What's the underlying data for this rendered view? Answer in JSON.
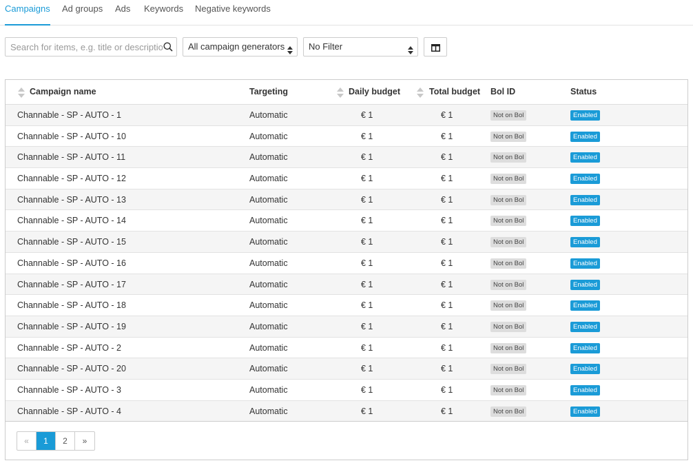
{
  "tabs": [
    {
      "label": "Campaigns",
      "active": true
    },
    {
      "label": "Ad groups",
      "active": false
    },
    {
      "label": "Ads",
      "active": false
    },
    {
      "label": "Keywords",
      "active": false
    },
    {
      "label": "Negative keywords",
      "active": false
    }
  ],
  "toolbar": {
    "search_placeholder": "Search for items, e.g. title or description",
    "search_value": "",
    "generator_select": "All campaign generators",
    "filter_select": "No Filter",
    "icons": {
      "search": "search-icon",
      "columns": "columns-icon",
      "caret": "sort-caret-icon"
    }
  },
  "table": {
    "headers": {
      "campaign_name": "Campaign name",
      "targeting": "Targeting",
      "daily_budget": "Daily budget",
      "total_budget": "Total budget",
      "bol_id": "Bol ID",
      "status": "Status"
    },
    "rows": [
      {
        "name": "Channable - SP - AUTO - 1",
        "targeting": "Automatic",
        "daily": "€ 1",
        "total": "€ 1",
        "bol": "Not on Bol",
        "status": "Enabled"
      },
      {
        "name": "Channable - SP - AUTO - 10",
        "targeting": "Automatic",
        "daily": "€ 1",
        "total": "€ 1",
        "bol": "Not on Bol",
        "status": "Enabled"
      },
      {
        "name": "Channable - SP - AUTO - 11",
        "targeting": "Automatic",
        "daily": "€ 1",
        "total": "€ 1",
        "bol": "Not on Bol",
        "status": "Enabled"
      },
      {
        "name": "Channable - SP - AUTO - 12",
        "targeting": "Automatic",
        "daily": "€ 1",
        "total": "€ 1",
        "bol": "Not on Bol",
        "status": "Enabled"
      },
      {
        "name": "Channable - SP - AUTO - 13",
        "targeting": "Automatic",
        "daily": "€ 1",
        "total": "€ 1",
        "bol": "Not on Bol",
        "status": "Enabled"
      },
      {
        "name": "Channable - SP - AUTO - 14",
        "targeting": "Automatic",
        "daily": "€ 1",
        "total": "€ 1",
        "bol": "Not on Bol",
        "status": "Enabled"
      },
      {
        "name": "Channable - SP - AUTO - 15",
        "targeting": "Automatic",
        "daily": "€ 1",
        "total": "€ 1",
        "bol": "Not on Bol",
        "status": "Enabled"
      },
      {
        "name": "Channable - SP - AUTO - 16",
        "targeting": "Automatic",
        "daily": "€ 1",
        "total": "€ 1",
        "bol": "Not on Bol",
        "status": "Enabled"
      },
      {
        "name": "Channable - SP - AUTO - 17",
        "targeting": "Automatic",
        "daily": "€ 1",
        "total": "€ 1",
        "bol": "Not on Bol",
        "status": "Enabled"
      },
      {
        "name": "Channable - SP - AUTO - 18",
        "targeting": "Automatic",
        "daily": "€ 1",
        "total": "€ 1",
        "bol": "Not on Bol",
        "status": "Enabled"
      },
      {
        "name": "Channable - SP - AUTO - 19",
        "targeting": "Automatic",
        "daily": "€ 1",
        "total": "€ 1",
        "bol": "Not on Bol",
        "status": "Enabled"
      },
      {
        "name": "Channable - SP - AUTO - 2",
        "targeting": "Automatic",
        "daily": "€ 1",
        "total": "€ 1",
        "bol": "Not on Bol",
        "status": "Enabled"
      },
      {
        "name": "Channable - SP - AUTO - 20",
        "targeting": "Automatic",
        "daily": "€ 1",
        "total": "€ 1",
        "bol": "Not on Bol",
        "status": "Enabled"
      },
      {
        "name": "Channable - SP - AUTO - 3",
        "targeting": "Automatic",
        "daily": "€ 1",
        "total": "€ 1",
        "bol": "Not on Bol",
        "status": "Enabled"
      },
      {
        "name": "Channable - SP - AUTO - 4",
        "targeting": "Automatic",
        "daily": "€ 1",
        "total": "€ 1",
        "bol": "Not on Bol",
        "status": "Enabled"
      }
    ]
  },
  "pagination": {
    "prev": "«",
    "pages": [
      "1",
      "2"
    ],
    "current": "1",
    "next": "»"
  },
  "colors": {
    "accent": "#1a9bd7",
    "badge_neutral": "#dddddd",
    "row_alt": "#f5f5f5"
  }
}
